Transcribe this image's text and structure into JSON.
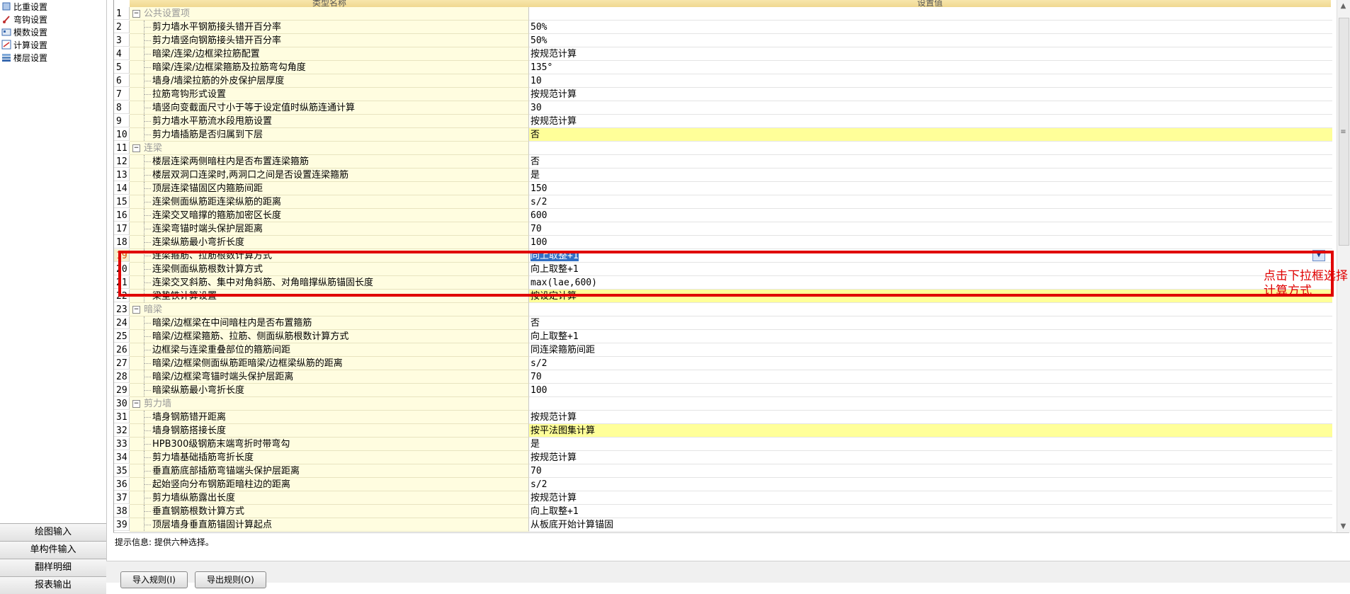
{
  "sidebar": {
    "tree": [
      {
        "label": "比重设置",
        "icon": "ratio-icon"
      },
      {
        "label": "弯钩设置",
        "icon": "hook-icon"
      },
      {
        "label": "模数设置",
        "icon": "modulus-icon"
      },
      {
        "label": "计算设置",
        "icon": "calc-settings-icon"
      },
      {
        "label": "楼层设置",
        "icon": "floor-icon"
      }
    ],
    "buttons": [
      "绘图输入",
      "单构件输入",
      "翻样明细",
      "报表输出"
    ]
  },
  "grid": {
    "header_name": "类型名称",
    "header_value": "设置值",
    "rows": [
      {
        "n": "1",
        "name": "公共设置项",
        "value": "",
        "group": true
      },
      {
        "n": "2",
        "name": "剪力墙水平钢筋接头错开百分率",
        "value": "50%"
      },
      {
        "n": "3",
        "name": "剪力墙竖向钢筋接头错开百分率",
        "value": "50%"
      },
      {
        "n": "4",
        "name": "暗梁/连梁/边框梁拉筋配置",
        "value": "按规范计算"
      },
      {
        "n": "5",
        "name": "暗梁/连梁/边框梁箍筋及拉筋弯勾角度",
        "value": "135°"
      },
      {
        "n": "6",
        "name": "墙身/墙梁拉筋的外皮保护层厚度",
        "value": "10"
      },
      {
        "n": "7",
        "name": "拉筋弯钩形式设置",
        "value": "按规范计算"
      },
      {
        "n": "8",
        "name": "墙竖向变截面尺寸小于等于设定值时纵筋连通计算",
        "value": "30"
      },
      {
        "n": "9",
        "name": "剪力墙水平筋流水段甩筋设置",
        "value": "按规范计算"
      },
      {
        "n": "10",
        "name": "剪力墙插筋是否归属到下层",
        "value": "否",
        "yellow": true
      },
      {
        "n": "11",
        "name": "连梁",
        "value": "",
        "group": true
      },
      {
        "n": "12",
        "name": "楼层连梁两侧暗柱内是否布置连梁箍筋",
        "value": "否"
      },
      {
        "n": "13",
        "name": "楼层双洞口连梁时,两洞口之间是否设置连梁箍筋",
        "value": "是"
      },
      {
        "n": "14",
        "name": "顶层连梁锚固区内箍筋间距",
        "value": "150"
      },
      {
        "n": "15",
        "name": "连梁侧面纵筋距连梁纵筋的距离",
        "value": "s/2"
      },
      {
        "n": "16",
        "name": "连梁交叉暗撑的箍筋加密区长度",
        "value": "600"
      },
      {
        "n": "17",
        "name": "连梁弯锚时端头保护层距离",
        "value": "70"
      },
      {
        "n": "18",
        "name": "连梁纵筋最小弯折长度",
        "value": "100"
      },
      {
        "n": "19",
        "name": "连梁箍筋、拉筋根数计算方式",
        "value": "向上取整+1",
        "selected": true
      },
      {
        "n": "20",
        "name": "连梁侧面纵筋根数计算方式",
        "value": "向上取整+1"
      },
      {
        "n": "21",
        "name": "连梁交叉斜筋、集中对角斜筋、对角暗撑纵筋锚固长度",
        "value": "max(lae,600)"
      },
      {
        "n": "22",
        "name": "梁垫铁计算设置",
        "value": "按设定计算",
        "yellow": true
      },
      {
        "n": "23",
        "name": "暗梁",
        "value": "",
        "group": true
      },
      {
        "n": "24",
        "name": "暗梁/边框梁在中间暗柱内是否布置箍筋",
        "value": "否"
      },
      {
        "n": "25",
        "name": "暗梁/边框梁箍筋、拉筋、侧面纵筋根数计算方式",
        "value": "向上取整+1"
      },
      {
        "n": "26",
        "name": "边框梁与连梁重叠部位的箍筋间距",
        "value": "同连梁箍筋间距"
      },
      {
        "n": "27",
        "name": "暗梁/边框梁侧面纵筋距暗梁/边框梁纵筋的距离",
        "value": "s/2"
      },
      {
        "n": "28",
        "name": "暗梁/边框梁弯锚时端头保护层距离",
        "value": "70"
      },
      {
        "n": "29",
        "name": "暗梁纵筋最小弯折长度",
        "value": "100"
      },
      {
        "n": "30",
        "name": "剪力墙",
        "value": "",
        "group": true
      },
      {
        "n": "31",
        "name": "墙身钢筋错开距离",
        "value": "按规范计算"
      },
      {
        "n": "32",
        "name": "墙身钢筋搭接长度",
        "value": "按平法图集计算",
        "yellow": true
      },
      {
        "n": "33",
        "name": "HPB300级钢筋末端弯折时带弯勾",
        "value": "是"
      },
      {
        "n": "34",
        "name": "剪力墙基础插筋弯折长度",
        "value": "按规范计算"
      },
      {
        "n": "35",
        "name": "垂直筋底部插筋弯锚端头保护层距离",
        "value": "70"
      },
      {
        "n": "36",
        "name": "起始竖向分布钢筋距暗柱边的距离",
        "value": "s/2"
      },
      {
        "n": "37",
        "name": "剪力墙纵筋露出长度",
        "value": "按规范计算"
      },
      {
        "n": "38",
        "name": "垂直钢筋根数计算方式",
        "value": "向上取整+1"
      },
      {
        "n": "39",
        "name": "顶层墙身垂直筋锚固计算起点",
        "value": "从板底开始计算锚固"
      }
    ]
  },
  "status": {
    "hint": "提示信息: 提供六种选择。"
  },
  "bottom": {
    "import_label": "导入规则(I)",
    "export_label": "导出规则(O)"
  },
  "annotation": {
    "text": "点击下拉框选择计算方式"
  },
  "colors": {
    "accent_red": "#e00000",
    "header_gold": "#f0d890",
    "name_bg": "#fffde0",
    "highlight_yellow": "#ffff99"
  }
}
